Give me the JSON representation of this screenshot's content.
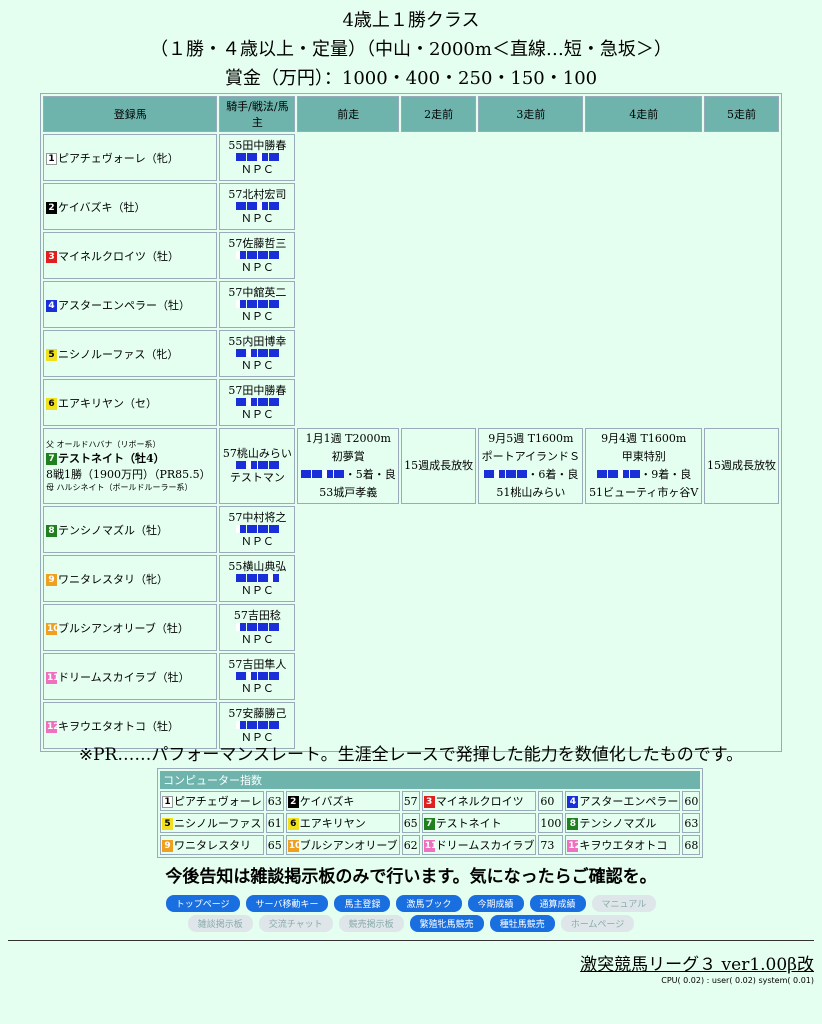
{
  "header": {
    "line1": "4歳上１勝クラス",
    "line2": "（１勝・４歳以上・定量）（中山・2000m＜直線…短・急坂＞）",
    "line3": "賞金（万円）：1000・400・250・150・100"
  },
  "table": {
    "columns": [
      "登録馬",
      "騎手/戦法/馬主",
      "前走",
      "2走前",
      "3走前",
      "4走前",
      "5走前"
    ],
    "horses": [
      {
        "num": "1",
        "name": "ピアチェヴォーレ（牝）",
        "jockey": "55田中勝春",
        "owner": "ＮＰＣ",
        "waku_bg": "#ffffff",
        "waku_fg": "#000000",
        "bars": [
          "f",
          "f",
          "t",
          "f"
        ]
      },
      {
        "num": "2",
        "name": "ケイバズキ（牡）",
        "jockey": "57北村宏司",
        "owner": "ＮＰＣ",
        "waku_bg": "#000000",
        "waku_fg": "#ffffff",
        "bars": [
          "f",
          "f",
          "t",
          "f"
        ]
      },
      {
        "num": "3",
        "name": "マイネルクロイツ（牡）",
        "jockey": "57佐藤哲三",
        "owner": "ＮＰＣ",
        "waku_bg": "#e02020",
        "waku_fg": "#ffffff",
        "bars": [
          "t",
          "f",
          "f",
          "f"
        ]
      },
      {
        "num": "4",
        "name": "アスターエンペラー（牡）",
        "jockey": "57中舘英二",
        "owner": "ＮＰＣ",
        "waku_bg": "#1a2fd8",
        "waku_fg": "#ffffff",
        "bars": [
          "t",
          "f",
          "f",
          "f"
        ]
      },
      {
        "num": "5",
        "name": "ニシノルーファス（牝）",
        "jockey": "55内田博幸",
        "owner": "ＮＰＣ",
        "waku_bg": "#f0e020",
        "waku_fg": "#000000",
        "bars": [
          "f",
          "t",
          "f",
          "f"
        ]
      },
      {
        "num": "6",
        "name": "エアキリヤン（セ）",
        "jockey": "57田中勝春",
        "owner": "ＮＰＣ",
        "waku_bg": "#f0e020",
        "waku_fg": "#000000",
        "bars": [
          "f",
          "t",
          "f",
          "f"
        ]
      },
      {
        "num": "7",
        "name": "テストネイト（牡4）",
        "jockey": "57桃山みらい",
        "owner": "テストマン",
        "waku_bg": "#208020",
        "waku_fg": "#ffffff",
        "bars": [
          "f",
          "t",
          "f",
          "f"
        ],
        "featured": true,
        "father": "父 オールドハバナ（リボー系）",
        "record": "8戦1勝（1900万円）（PR85.5）",
        "mother": "母 ハルシネイト（ボールドルーラー系）",
        "races": [
          {
            "date": "1月1週 T2000m",
            "race": "初夢賞",
            "result": "・5着・良",
            "rider": "53城戸孝義",
            "bars": [
              "f",
              "f",
              "t",
              "f"
            ]
          },
          {
            "text": "15週成長放牧"
          },
          {
            "date": "9月5週 T1600m",
            "race": "ポートアイランドＳ",
            "result": "・6着・良",
            "rider": "51桃山みらい",
            "bars": [
              "f",
              "t",
              "f",
              "f"
            ]
          },
          {
            "date": "9月4週 T1600m",
            "race": "甲東特別",
            "result": "・9着・良",
            "rider": "51ビューティ市ヶ谷V",
            "bars": [
              "f",
              "f",
              "t",
              "f"
            ]
          },
          {
            "text": "15週成長放牧"
          }
        ]
      },
      {
        "num": "8",
        "name": "テンシノマズル（牡）",
        "jockey": "57中村将之",
        "owner": "ＮＰＣ",
        "waku_bg": "#208020",
        "waku_fg": "#ffffff",
        "bars": [
          "t",
          "f",
          "f",
          "f"
        ]
      },
      {
        "num": "9",
        "name": "ワニタレスタリ（牝）",
        "jockey": "55横山典弘",
        "owner": "ＮＰＣ",
        "waku_bg": "#f0a020",
        "waku_fg": "#ffffff",
        "bars": [
          "f",
          "f",
          "f",
          "t"
        ]
      },
      {
        "num": "10",
        "name": "ブルシアンオリーブ（牡）",
        "jockey": "57吉田稔",
        "owner": "ＮＰＣ",
        "waku_bg": "#f0a020",
        "waku_fg": "#ffffff",
        "bars": [
          "t",
          "f",
          "f",
          "f"
        ]
      },
      {
        "num": "11",
        "name": "ドリームスカイラブ（牡）",
        "jockey": "57吉田隼人",
        "owner": "ＮＰＣ",
        "waku_bg": "#f070c0",
        "waku_fg": "#ffffff",
        "bars": [
          "f",
          "t",
          "f",
          "f"
        ]
      },
      {
        "num": "12",
        "name": "キヲウエタオトコ（牡）",
        "jockey": "57安藤勝己",
        "owner": "ＮＰＣ",
        "waku_bg": "#f070c0",
        "waku_fg": "#ffffff",
        "bars": [
          "t",
          "f",
          "f",
          "f"
        ]
      }
    ]
  },
  "pr_note": "※PR……パフォーマンスレート。生涯全レースで発揮した能力を数値化したものです。",
  "cpu": {
    "title": "コンピューター指数",
    "rows": [
      [
        {
          "num": "1",
          "name": "ピアチェヴォーレ",
          "score": "63",
          "bg": "#ffffff",
          "fg": "#000000"
        },
        {
          "num": "2",
          "name": "ケイバズキ",
          "score": "57",
          "bg": "#000000",
          "fg": "#ffffff"
        },
        {
          "num": "3",
          "name": "マイネルクロイツ",
          "score": "60",
          "bg": "#e02020",
          "fg": "#ffffff"
        },
        {
          "num": "4",
          "name": "アスターエンペラー",
          "score": "60",
          "bg": "#1a2fd8",
          "fg": "#ffffff"
        }
      ],
      [
        {
          "num": "5",
          "name": "ニシノルーファス",
          "score": "61",
          "bg": "#f0e020",
          "fg": "#000000"
        },
        {
          "num": "6",
          "name": "エアキリヤン",
          "score": "65",
          "bg": "#f0e020",
          "fg": "#000000"
        },
        {
          "num": "7",
          "name": "テストネイト",
          "score": "100",
          "bg": "#208020",
          "fg": "#ffffff"
        },
        {
          "num": "8",
          "name": "テンシノマズル",
          "score": "63",
          "bg": "#208020",
          "fg": "#ffffff"
        }
      ],
      [
        {
          "num": "9",
          "name": "ワニタレスタリ",
          "score": "65",
          "bg": "#f0a020",
          "fg": "#ffffff"
        },
        {
          "num": "10",
          "name": "ブルシアンオリーブ",
          "score": "62",
          "bg": "#f0a020",
          "fg": "#ffffff"
        },
        {
          "num": "11",
          "name": "ドリームスカイラブ",
          "score": "73",
          "bg": "#f070c0",
          "fg": "#ffffff"
        },
        {
          "num": "12",
          "name": "キヲウエタオトコ",
          "score": "68",
          "bg": "#f070c0",
          "fg": "#ffffff"
        }
      ]
    ]
  },
  "notice": "今後告知は雑談掲示板のみで行います。気になったらご確認を。",
  "nav_row1": [
    {
      "label": "トップページ",
      "active": true
    },
    {
      "label": "サーバ移動キー",
      "active": true
    },
    {
      "label": "馬主登録",
      "active": true
    },
    {
      "label": "激馬ブック",
      "active": true
    },
    {
      "label": "今期成績",
      "active": true
    },
    {
      "label": "通算成績",
      "active": true
    },
    {
      "label": "マニュアル",
      "active": false
    }
  ],
  "nav_row2": [
    {
      "label": "雑談掲示板",
      "active": false
    },
    {
      "label": "交流チャット",
      "active": false
    },
    {
      "label": "競売掲示板",
      "active": false
    },
    {
      "label": "繁殖牝馬競売",
      "active": true
    },
    {
      "label": "種牡馬競売",
      "active": true
    },
    {
      "label": "ホームページ",
      "active": false
    }
  ],
  "footer": {
    "title": "激突競馬リーグ３ ver1.00β改",
    "cpu": "CPU( 0.02) : user( 0.02) system( 0.01)"
  },
  "colors": {
    "background": "#e4fff0",
    "header_cell": "#6fb3ad",
    "bar": "#1a2fd8",
    "button": "#1a6fe0"
  }
}
